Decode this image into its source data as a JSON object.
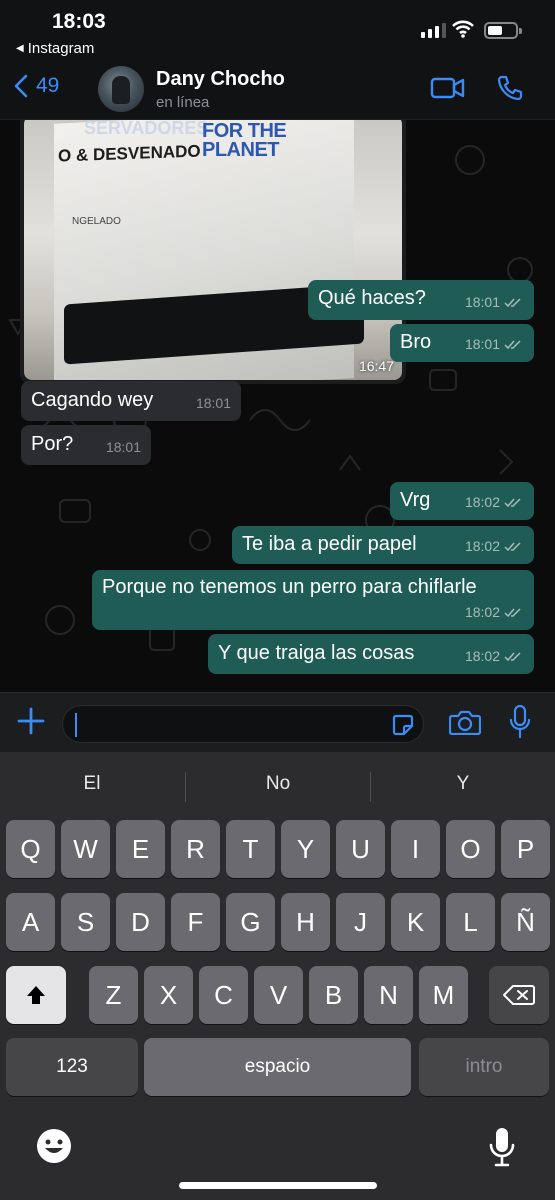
{
  "status_bar": {
    "time": "18:03",
    "back_app": "Instagram"
  },
  "header": {
    "back_count": "49",
    "contact_name": "Dany Chocho",
    "presence": "en línea"
  },
  "photo_message": {
    "texts": [
      "FOR THE PLANET",
      "O & DESVENADO",
      "NGELADO",
      "SERVADORES"
    ],
    "time": "16:47"
  },
  "messages": [
    {
      "direction": "out",
      "text": "Qué haces?",
      "time": "18:01"
    },
    {
      "direction": "out",
      "text": "Bro",
      "time": "18:01"
    },
    {
      "direction": "in",
      "text": "Cagando wey",
      "time": "18:01"
    },
    {
      "direction": "in",
      "text": "Por?",
      "time": "18:01"
    },
    {
      "direction": "out",
      "text": "Vrg",
      "time": "18:02"
    },
    {
      "direction": "out",
      "text": "Te iba a pedir papel",
      "time": "18:02"
    },
    {
      "direction": "out",
      "text": "Porque no tenemos un perro para chiflarle",
      "time": "18:02"
    },
    {
      "direction": "out",
      "text": "Y que traiga las cosas",
      "time": "18:02"
    }
  ],
  "input": {
    "value": ""
  },
  "keyboard": {
    "suggestions": [
      "El",
      "No",
      "Y"
    ],
    "row1": [
      "Q",
      "W",
      "E",
      "R",
      "T",
      "Y",
      "U",
      "I",
      "O",
      "P"
    ],
    "row2": [
      "A",
      "S",
      "D",
      "F",
      "G",
      "H",
      "J",
      "K",
      "L",
      "Ñ"
    ],
    "row3": [
      "Z",
      "X",
      "C",
      "V",
      "B",
      "N",
      "M"
    ],
    "numbers_label": "123",
    "space_label": "espacio",
    "return_label": "intro"
  },
  "colors": {
    "accent": "#3b8cf6",
    "outgoing_bubble": "#1e5c55",
    "incoming_bubble": "#2b2c2f",
    "keyboard_bg": "#2c2c2e"
  },
  "icons": [
    "signal-icon",
    "wifi-icon",
    "battery-icon",
    "back-chevron-icon",
    "video-call-icon",
    "phone-icon",
    "plus-icon",
    "sticker-icon",
    "camera-icon",
    "microphone-icon",
    "shift-icon",
    "backspace-icon",
    "emoji-icon",
    "dictation-icon",
    "double-check-icon"
  ]
}
